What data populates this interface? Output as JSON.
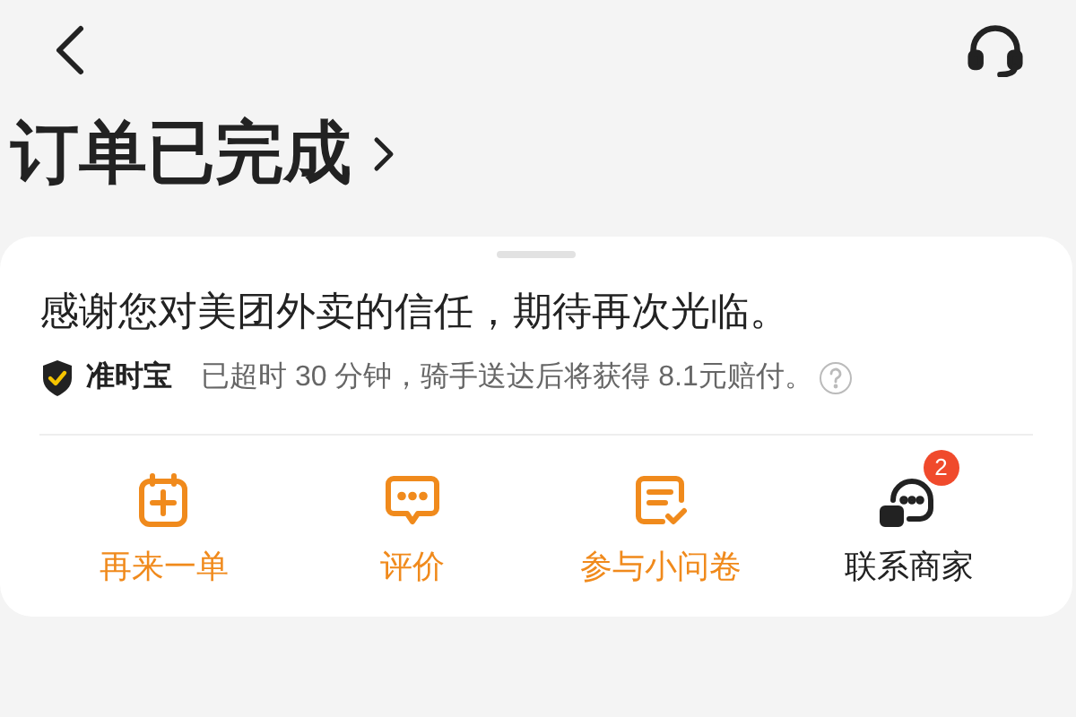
{
  "header": {
    "title": "订单已完成"
  },
  "card": {
    "message": "感谢您对美团外卖的信任，期待再次光临。",
    "guarantee": {
      "label": "准时宝",
      "text": "已超时 30 分钟，骑手送达后将获得 8.1元赔付。"
    },
    "actions": [
      {
        "kind": "reorder",
        "label": "再来一单",
        "color": "#f08a1c"
      },
      {
        "kind": "review",
        "label": "评价",
        "color": "#f08a1c"
      },
      {
        "kind": "survey",
        "label": "参与小问卷",
        "color": "#f08a1c"
      },
      {
        "kind": "contact",
        "label": "联系商家",
        "color": "#222222",
        "badge": "2"
      }
    ]
  }
}
